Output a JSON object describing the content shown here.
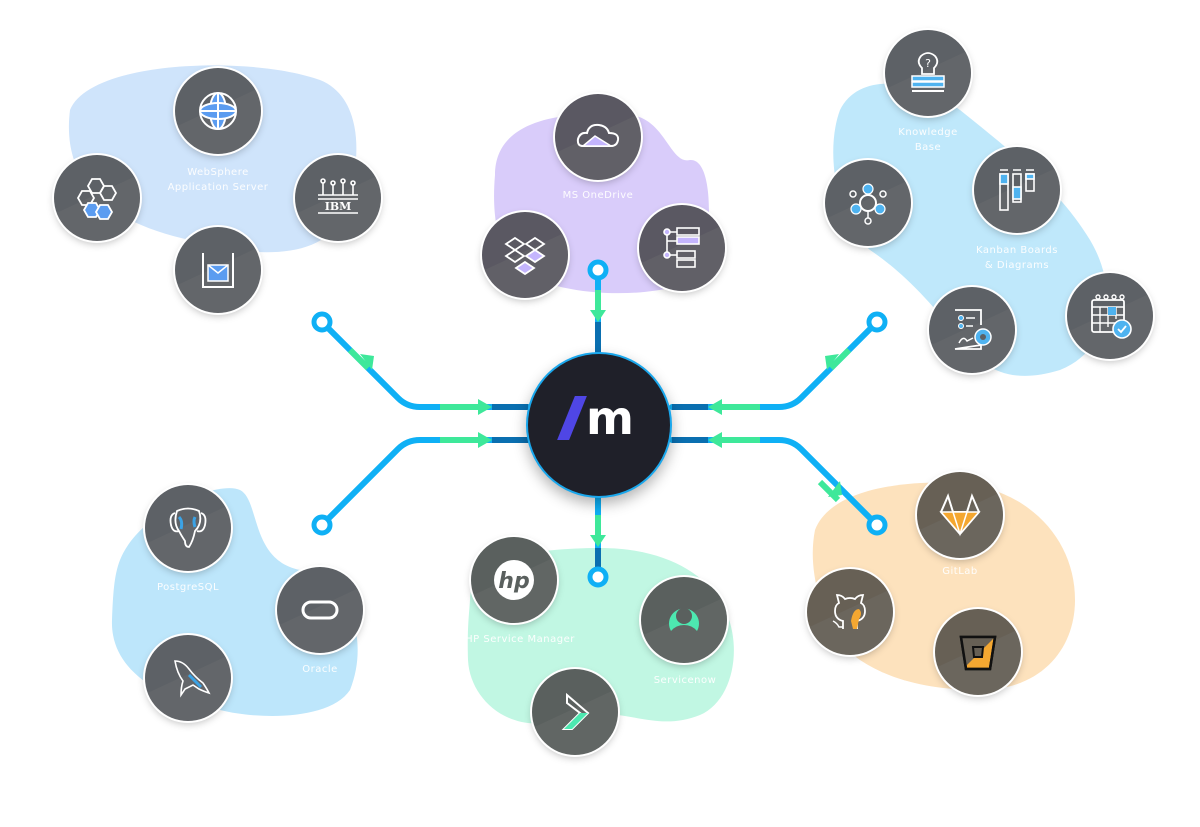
{
  "diagram": {
    "hub": {
      "logo_slash": "/",
      "logo_letter": "m",
      "accent_color": "#4f46e5",
      "ring_color": "#1aa7ec"
    },
    "connector_colors": {
      "line": "#0fb0f5",
      "arrow": "#3ee89a"
    },
    "groups": [
      {
        "id": "app-servers",
        "blob_color": "#cfe4fb",
        "icon_accent": "#5b9cf0",
        "labels": [
          "WebSphere",
          "Application Server"
        ],
        "nodes": [
          {
            "name": "websphere",
            "icon": "globe-icon"
          },
          {
            "name": "hexagon-network",
            "icon": "hexagon-cluster-icon"
          },
          {
            "name": "ibm",
            "icon": "ibm-icon"
          },
          {
            "name": "message-queue",
            "icon": "inbox-icon"
          }
        ]
      },
      {
        "id": "file-storage",
        "blob_color": "#d9ccfa",
        "icon_accent": "#c4b5fd",
        "labels": [
          "MS OneDrive"
        ],
        "nodes": [
          {
            "name": "onedrive",
            "icon": "cloud-icon"
          },
          {
            "name": "dropbox",
            "icon": "dropbox-icon"
          },
          {
            "name": "hierarchy",
            "icon": "tree-icon"
          }
        ]
      },
      {
        "id": "collaboration",
        "blob_color": "#bfe8fb",
        "icon_accent": "#4fb3f0",
        "labels": [
          "Knowledge",
          "Base",
          "Kanban Boards",
          "& Diagrams"
        ],
        "nodes": [
          {
            "name": "knowledge-base",
            "icon": "lightbulb-books-icon"
          },
          {
            "name": "integration-hub",
            "icon": "gear-network-icon"
          },
          {
            "name": "kanban",
            "icon": "kanban-icon"
          },
          {
            "name": "document-settings",
            "icon": "document-gear-icon"
          },
          {
            "name": "calendar",
            "icon": "calendar-check-icon"
          }
        ]
      },
      {
        "id": "databases",
        "blob_color": "#bde6fb",
        "icon_accent": "#3ba3e6",
        "labels": [
          "PostgreSQL",
          "Oracle"
        ],
        "nodes": [
          {
            "name": "postgresql",
            "icon": "elephant-icon"
          },
          {
            "name": "oracle",
            "icon": "oracle-icon"
          },
          {
            "name": "mysql",
            "icon": "dolphin-icon"
          }
        ]
      },
      {
        "id": "itsm",
        "blob_color": "#c1f7e3",
        "icon_accent": "#4de8b0",
        "labels": [
          "HP Service Manager",
          "Servicenow"
        ],
        "nodes": [
          {
            "name": "hp",
            "icon": "hp-icon"
          },
          {
            "name": "servicenow",
            "icon": "servicenow-icon"
          },
          {
            "name": "bmc",
            "icon": "chevron-logo-icon"
          }
        ]
      },
      {
        "id": "vcs",
        "blob_color": "#fde2bd",
        "icon_accent": "#f4a731",
        "labels": [
          "GitLab"
        ],
        "nodes": [
          {
            "name": "gitlab",
            "icon": "fox-icon"
          },
          {
            "name": "github",
            "icon": "octocat-icon"
          },
          {
            "name": "bitbucket",
            "icon": "bucket-icon"
          }
        ]
      }
    ]
  }
}
